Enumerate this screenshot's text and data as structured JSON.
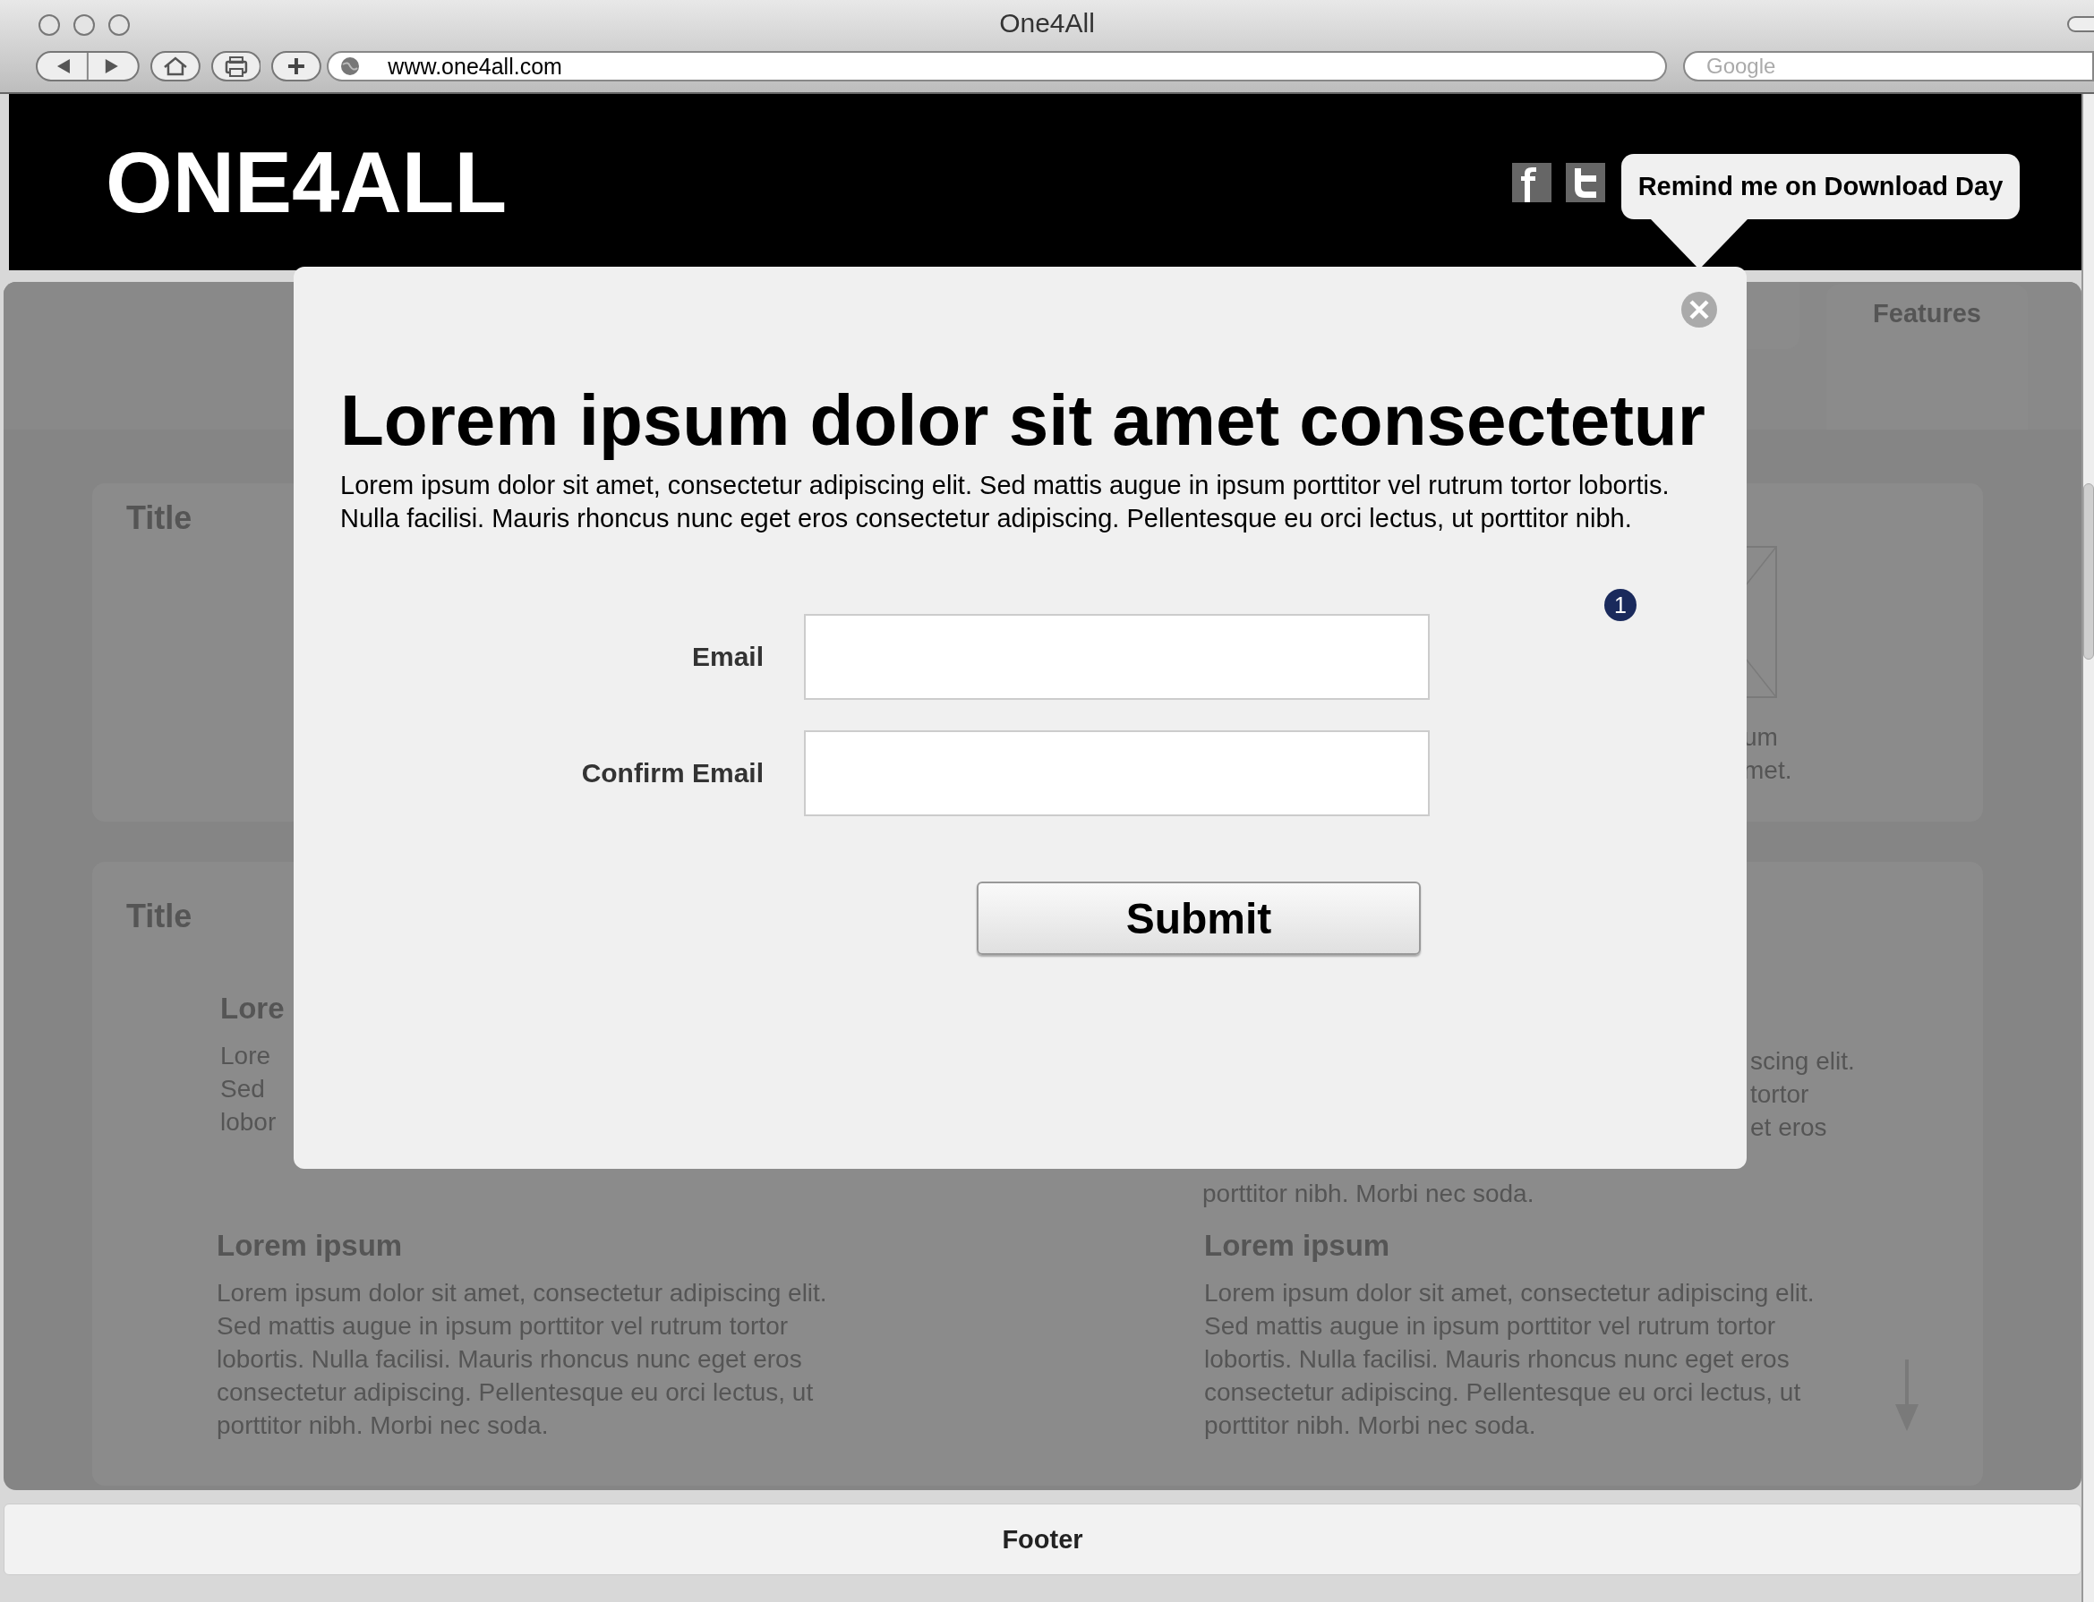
{
  "window": {
    "title": "One4All"
  },
  "toolbar": {
    "address": "www.one4all.com",
    "search": {
      "placeholder": "Google"
    }
  },
  "header": {
    "logo": "ONE4ALL",
    "reminder_button": "Remind me on Download Day"
  },
  "page": {
    "feature_tab": "Features",
    "card_1": {
      "title": "Title",
      "caption_fragments": [
        "um",
        "met."
      ]
    },
    "card_2": {
      "title": "Title",
      "left_fragment": {
        "heading": "Lore",
        "lines": [
          "Lore",
          "Sed",
          "lobor"
        ]
      },
      "right_fragments": [
        "scing elit.",
        "tortor",
        "et eros"
      ],
      "right_last_line": "porttitor nibh. Morbi nec soda.",
      "sections": [
        {
          "heading": "Lorem ipsum",
          "text": "Lorem ipsum dolor sit amet, consectetur adipiscing elit. Sed mattis augue in ipsum porttitor vel rutrum tortor lobortis. Nulla facilisi. Mauris rhoncus nunc eget eros consectetur adipiscing. Pellentesque eu orci lectus, ut porttitor nibh. Morbi nec soda."
        },
        {
          "heading": "Lorem ipsum",
          "text": "Lorem ipsum dolor sit amet, consectetur adipiscing elit. Sed mattis augue in ipsum porttitor vel rutrum tortor lobortis. Nulla facilisi. Mauris rhoncus nunc eget eros consectetur adipiscing. Pellentesque eu orci lectus, ut porttitor nibh. Morbi nec soda."
        }
      ]
    }
  },
  "modal": {
    "heading": "Lorem ipsum dolor sit amet consectetur",
    "text": "Lorem ipsum dolor sit amet, consectetur adipiscing elit. Sed mattis augue in ipsum porttitor vel rutrum tortor lobortis. Nulla facilisi. Mauris rhoncus nunc eget eros consectetur adipiscing. Pellentesque eu orci lectus, ut porttitor nibh.",
    "badge": "1",
    "fields": [
      {
        "label": "Email"
      },
      {
        "label": "Confirm Email"
      }
    ],
    "submit": "Submit"
  },
  "footer": {
    "text": "Footer"
  }
}
